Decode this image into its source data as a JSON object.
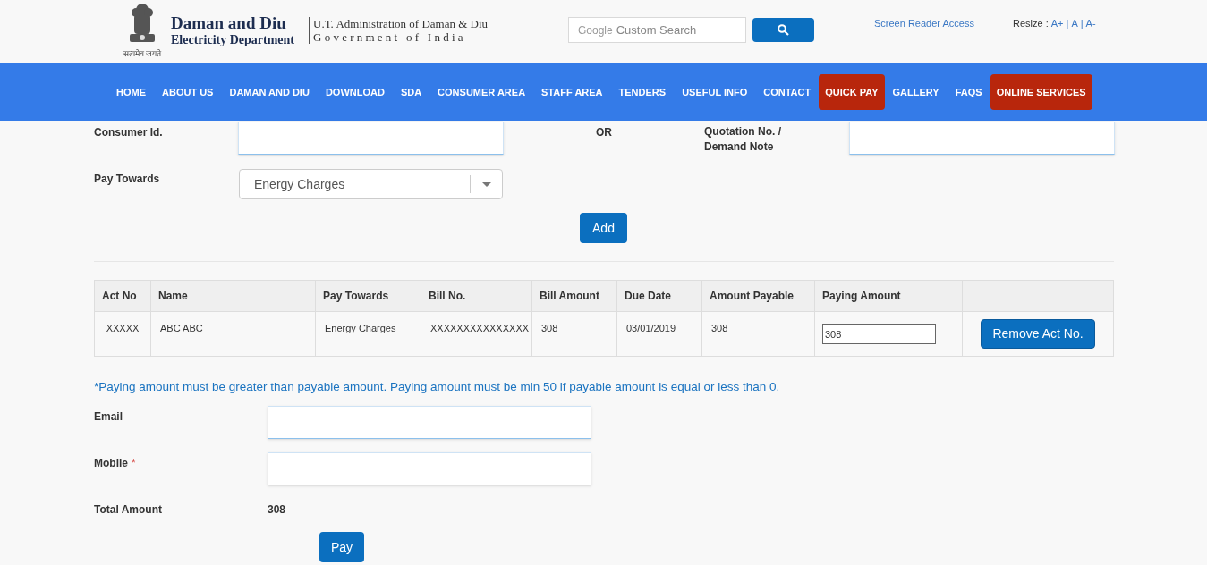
{
  "header": {
    "title": "Daman and Diu",
    "subtitle": "Electricity Department",
    "admin": "U.T. Administration of Daman & Diu",
    "government": "G o v e r n m e n t   o f   I n d i a",
    "motto": "सत्यमेव जयते"
  },
  "search": {
    "brand": "Google",
    "placeholder": "Custom Search"
  },
  "screen_reader": "Screen Reader Access",
  "resize": {
    "label": "Resize :",
    "options": [
      "A+",
      "A",
      "A-"
    ],
    "separator": "|"
  },
  "nav": [
    {
      "label": "HOME",
      "highlighted": false
    },
    {
      "label": "ABOUT US",
      "highlighted": false
    },
    {
      "label": "DAMAN AND DIU",
      "highlighted": false
    },
    {
      "label": "DOWNLOAD",
      "highlighted": false
    },
    {
      "label": "SDA",
      "highlighted": false
    },
    {
      "label": "CONSUMER AREA",
      "highlighted": false
    },
    {
      "label": "STAFF AREA",
      "highlighted": false
    },
    {
      "label": "TENDERS",
      "highlighted": false
    },
    {
      "label": "USEFUL INFO",
      "highlighted": false
    },
    {
      "label": "CONTACT",
      "highlighted": false
    },
    {
      "label": "QUICK PAY",
      "highlighted": true
    },
    {
      "label": "GALLERY",
      "highlighted": false
    },
    {
      "label": "FAQS",
      "highlighted": false
    },
    {
      "label": "ONLINE SERVICES",
      "highlighted": true
    }
  ],
  "form": {
    "consumer_label": "Consumer Id.",
    "or": "OR",
    "quotation_label": "Quotation No. / Demand Note",
    "pay_towards_label": "Pay Towards",
    "pay_towards_value": "Energy Charges",
    "add": "Add"
  },
  "table": {
    "columns": [
      "Act No",
      "Name",
      "Pay Towards",
      "Bill No.",
      "Bill Amount",
      "Due Date",
      "Amount Payable",
      "Paying Amount"
    ],
    "rows": [
      {
        "cells": [
          "XXXXX",
          "ABC ABC",
          "Energy Charges",
          "XXXXXXXXXXXXXXX",
          "308",
          "03/01/2019",
          "308"
        ],
        "paying": "308",
        "remove": "Remove Act No."
      }
    ]
  },
  "note": "*Paying amount must be greater than payable amount. Paying amount must be min 50 if payable amount is equal or less than 0.",
  "email_label": "Email",
  "mobile_label": "Mobile",
  "required_mark": "*",
  "total_label": "Total Amount",
  "total_value": "308",
  "pay": "Pay"
}
